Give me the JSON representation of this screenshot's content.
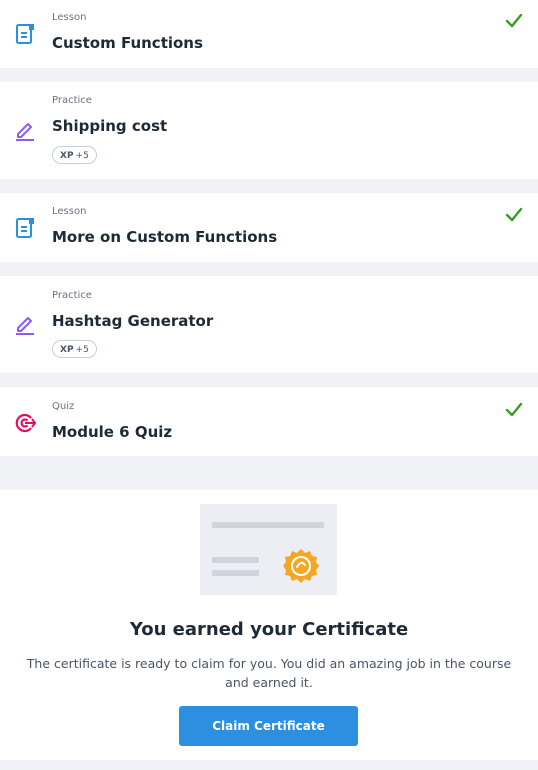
{
  "items": [
    {
      "kind": "Lesson",
      "title": "Custom Functions",
      "icon": "lesson-icon",
      "completed": true
    },
    {
      "kind": "Practice",
      "title": "Shipping cost",
      "icon": "practice-pencil-icon",
      "xp_label": "XP",
      "xp_value": "+5"
    },
    {
      "kind": "Lesson",
      "title": "More on Custom Functions",
      "icon": "lesson-icon",
      "completed": true
    },
    {
      "kind": "Practice",
      "title": "Hashtag Generator",
      "icon": "practice-pencil-icon",
      "xp_label": "XP",
      "xp_value": "+5"
    },
    {
      "kind": "Quiz",
      "title": "Module 6 Quiz",
      "icon": "quiz-target-icon",
      "completed": true
    }
  ],
  "certificate": {
    "heading": "You earned your Certificate",
    "description": "The certificate is ready to claim for you. You did an amazing job in the course and earned it.",
    "button_label": "Claim Certificate"
  },
  "colors": {
    "lesson_icon": "#2d8fe0",
    "practice_icon": "#8b5cf6",
    "quiz_icon": "#e0115f",
    "check": "#3a9d23",
    "button": "#2d8fe0",
    "seal": "#f5a623"
  }
}
